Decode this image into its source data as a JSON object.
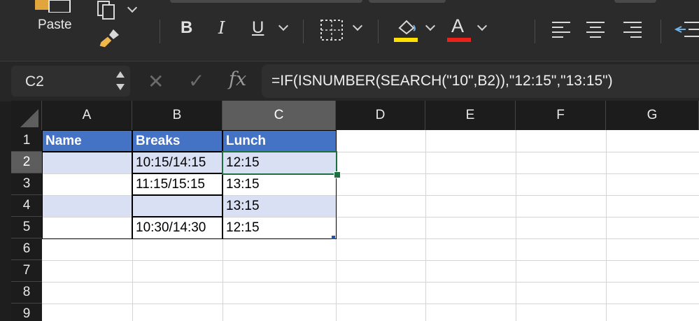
{
  "ribbon": {
    "paste_label": "Paste",
    "bold": "B",
    "italic": "I",
    "underline": "U",
    "font_color_letter": "A",
    "fill_color": "#ffe000",
    "font_color": "#e8231a"
  },
  "formula_bar": {
    "name_box": "C2",
    "fx": "fx",
    "formula": "=IF(ISNUMBER(SEARCH(\"10\",B2)),\"12:15\",\"13:15\")"
  },
  "sheet": {
    "columns": [
      "A",
      "B",
      "C",
      "D",
      "E",
      "F",
      "G"
    ],
    "rows": [
      "1",
      "2",
      "3",
      "4",
      "5",
      "6",
      "7",
      "8",
      "9"
    ],
    "cells": {
      "A1": "Name",
      "B1": "Breaks",
      "C1": "Lunch",
      "A2": "",
      "B2": "10:15/14:15",
      "C2": "12:15",
      "A3": "",
      "B3": "11:15/15:15",
      "C3": "13:15",
      "A4": "",
      "B4": "",
      "C4": "13:15",
      "A5": "",
      "B5": "10:30/14:30",
      "C5": "12:15"
    },
    "active_cell": "C2",
    "table_header_color": "#4472c4",
    "band_color": "#dae0f3"
  }
}
